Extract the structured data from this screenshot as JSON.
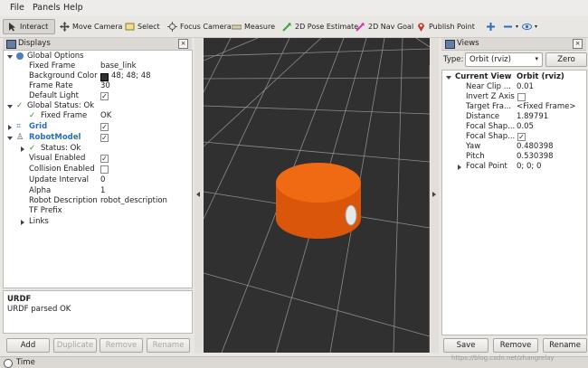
{
  "menubar": {
    "items": [
      "File",
      "Panels",
      "Help"
    ]
  },
  "toolbar": {
    "tools": [
      {
        "label": "Interact",
        "icon": "cursor-icon"
      },
      {
        "label": "Move Camera",
        "icon": "move-camera-icon"
      },
      {
        "label": "Select",
        "icon": "select-icon"
      },
      {
        "label": "Focus Camera",
        "icon": "focus-camera-icon"
      },
      {
        "label": "Measure",
        "icon": "measure-icon"
      },
      {
        "label": "2D Pose Estimate",
        "icon": "pose-estimate-icon"
      },
      {
        "label": "2D Nav Goal",
        "icon": "nav-goal-icon"
      },
      {
        "label": "Publish Point",
        "icon": "publish-point-icon"
      }
    ],
    "extras": [
      "plus-icon",
      "minus-icon",
      "eye-icon"
    ]
  },
  "displays": {
    "title": "Displays",
    "rows": [
      {
        "label": "Global Options",
        "value": ""
      },
      {
        "label": "Fixed Frame",
        "value": "base_link"
      },
      {
        "label": "Background Color",
        "value": "48; 48; 48"
      },
      {
        "label": "Frame Rate",
        "value": "30"
      },
      {
        "label": "Default Light",
        "value": ""
      },
      {
        "label": "Global Status: Ok",
        "value": ""
      },
      {
        "label": "Fixed Frame",
        "value": "OK"
      },
      {
        "label": "Grid",
        "value": ""
      },
      {
        "label": "RobotModel",
        "value": ""
      },
      {
        "label": "Status: Ok",
        "value": ""
      },
      {
        "label": "Visual Enabled",
        "value": ""
      },
      {
        "label": "Collision Enabled",
        "value": ""
      },
      {
        "label": "Update Interval",
        "value": "0"
      },
      {
        "label": "Alpha",
        "value": "1"
      },
      {
        "label": "Robot Description",
        "value": "robot_description"
      },
      {
        "label": "TF Prefix",
        "value": ""
      },
      {
        "label": "Links",
        "value": ""
      }
    ],
    "background_color_hex": "#303030",
    "status_title": "URDF",
    "status_text": "URDF parsed OK",
    "buttons": [
      "Add",
      "Duplicate",
      "Remove",
      "Rename"
    ]
  },
  "views": {
    "title": "Views",
    "type_label": "Type:",
    "type_value": "Orbit (rviz)",
    "zero_label": "Zero",
    "rows": [
      {
        "label": "Current View",
        "value": "Orbit (rviz)"
      },
      {
        "label": "Near Clip ...",
        "value": "0.01"
      },
      {
        "label": "Invert Z Axis",
        "value": ""
      },
      {
        "label": "Target Fra...",
        "value": "<Fixed Frame>"
      },
      {
        "label": "Distance",
        "value": "1.89791"
      },
      {
        "label": "Focal Shap...",
        "value": "0.05"
      },
      {
        "label": "Focal Shap...",
        "value": ""
      },
      {
        "label": "Yaw",
        "value": "0.480398"
      },
      {
        "label": "Pitch",
        "value": "0.530398"
      },
      {
        "label": "Focal Point",
        "value": "0; 0; 0"
      }
    ],
    "buttons": [
      "Save",
      "Remove",
      "Rename"
    ]
  },
  "time_panel": {
    "title": "Time"
  },
  "watermark": "https://blog.csdn.net/zhangrelay",
  "colors": {
    "robot_orange": "#e35a0a",
    "viewport_bg": "#303030",
    "accent_blue": "#2a6fbf",
    "status_green": "#2e8b2e"
  }
}
